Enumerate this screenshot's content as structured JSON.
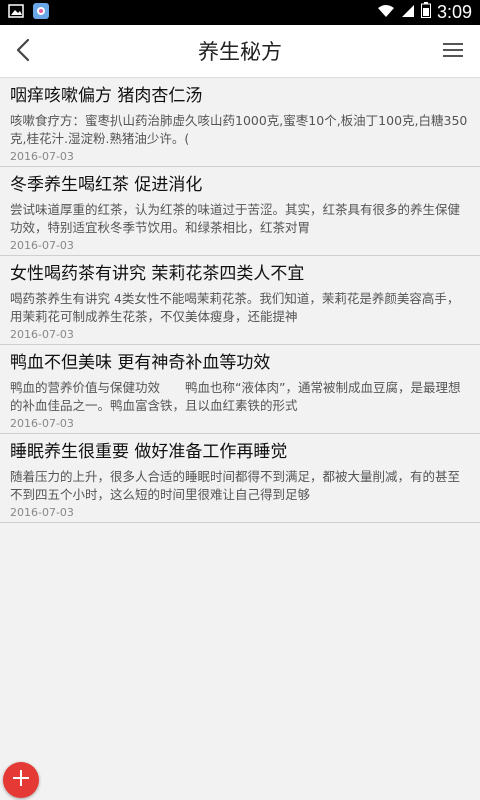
{
  "status_bar": {
    "time": "3:09",
    "icons": [
      "image-notification-icon",
      "app-notification-icon",
      "wifi-icon",
      "signal-icon",
      "battery-icon"
    ]
  },
  "app_bar": {
    "title": "养生秘方",
    "back_icon": "chevron-left-icon",
    "menu_icon": "hamburger-menu-icon"
  },
  "articles": [
    {
      "title": "咽痒咳嗽偏方 猪肉杏仁汤",
      "summary": "咳嗽食疗方：蜜枣扒山药治肺虚久咳山药1000克,蜜枣10个,板油丁100克,白糖350克,桂花汁.湿淀粉.熟猪油少许。(",
      "date": "2016-07-03"
    },
    {
      "title": "冬季养生喝红茶 促进消化",
      "summary": "尝试味道厚重的红茶，认为红茶的味道过于苦涩。其实，红茶具有很多的养生保健功效，特别适宜秋冬季节饮用。和绿茶相比，红茶对胃",
      "date": "2016-07-03"
    },
    {
      "title": "女性喝药茶有讲究 茉莉花茶四类人不宜",
      "summary": "喝药茶养生有讲究 4类女性不能喝茉莉花茶。我们知道，茉莉花是养颜美容高手，用茉莉花可制成养生花茶，不仅美体瘦身，还能提神",
      "date": "2016-07-03"
    },
    {
      "title": "鸭血不但美味 更有神奇补血等功效",
      "summary": "鸭血的营养价值与保健功效　　鸭血也称“液体肉”，通常被制成血豆腐，是最理想的补血佳品之一。鸭血富含铁，且以血红素铁的形式",
      "date": "2016-07-03"
    },
    {
      "title": "睡眠养生很重要 做好准备工作再睡觉",
      "summary": "随着压力的上升，很多人合适的睡眠时间都得不到满足，都被大量削减，有的甚至不到四五个小时，这么短的时间里很难让自己得到足够",
      "date": "2016-07-03"
    }
  ],
  "fab": {
    "icon": "plus-icon",
    "color": "#e53935"
  }
}
